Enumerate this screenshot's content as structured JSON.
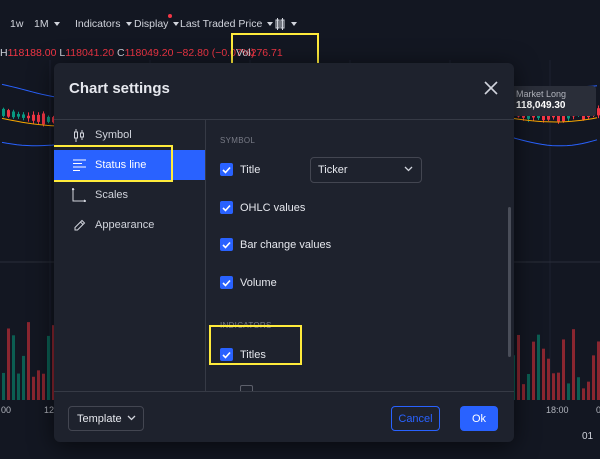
{
  "toolbar": {
    "interval_1w": "1w",
    "interval_1m": "1M",
    "indicators": "Indicators",
    "display": "Display",
    "price_source": "Last Traded Price"
  },
  "ohlc": {
    "h_label": "H",
    "h_value": "118188.00",
    "l_label": "L",
    "l_value": "118041.20",
    "c_label": "C",
    "c_value": "118049.20",
    "change": "−82.80 (−0.07%)",
    "vol_label": "Vol",
    "vol_value": "276.71"
  },
  "market_badge": {
    "title": "Market Long",
    "value": "118,049.30"
  },
  "time_axis": {
    "left_partial": "00",
    "left_mid": "12",
    "right_mid": "18:00",
    "right_partial": "0",
    "bottom_right": "01"
  },
  "modal": {
    "title": "Chart settings",
    "sidebar": [
      {
        "label": "Symbol",
        "icon": "candlestick-icon"
      },
      {
        "label": "Status line",
        "icon": "status-line-icon"
      },
      {
        "label": "Scales",
        "icon": "scales-icon"
      },
      {
        "label": "Appearance",
        "icon": "pencil-icon"
      }
    ],
    "symbol_section": "SYMBOL",
    "title_label": "Title",
    "title_select": "Ticker",
    "ohlc_label": "OHLC values",
    "bar_change_label": "Bar change values",
    "volume_label": "Volume",
    "indicators_section": "INDICATORS",
    "titles_label": "Titles",
    "template_label": "Template",
    "cancel_label": "Cancel",
    "ok_label": "Ok"
  },
  "colors": {
    "accent": "#2962ff",
    "highlight": "#ffeb3b",
    "up": "#089981",
    "down": "#f23645"
  }
}
